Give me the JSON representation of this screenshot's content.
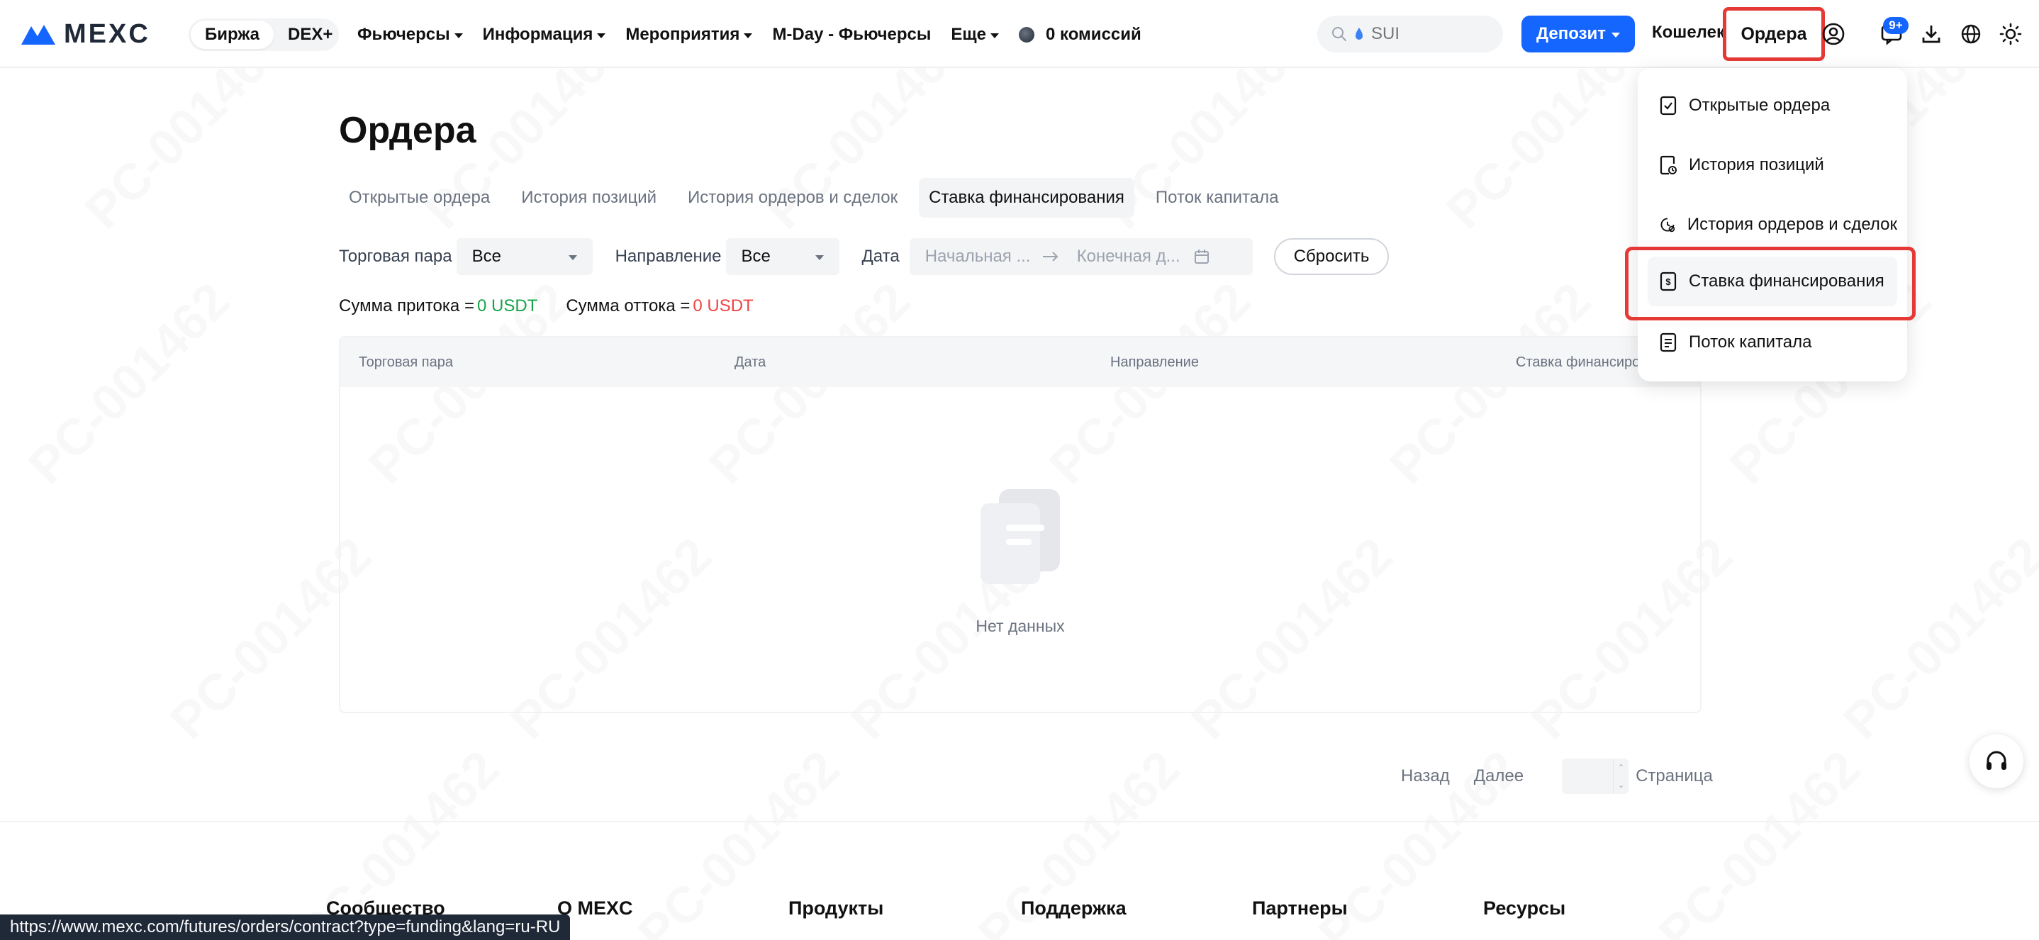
{
  "header": {
    "logo_text": "MEXC",
    "segments": [
      "Биржа",
      "DEX+"
    ],
    "nav": [
      {
        "label": "Фьючерсы",
        "caret": true
      },
      {
        "label": "Информация",
        "caret": true
      },
      {
        "label": "Мероприятия",
        "caret": true
      },
      {
        "label": "M-Day - Фьючерсы",
        "caret": false
      },
      {
        "label": "Еще",
        "caret": true
      }
    ],
    "zero_fee": "0 комиссий",
    "search": {
      "placeholder": "SUI",
      "icon": "search-icon"
    },
    "deposit_label": "Депозит",
    "wallet_label": "Кошелек",
    "orders_label": "Ордера",
    "badge": "9+",
    "brand_color": "#1565ff",
    "highlight_color": "#e53935"
  },
  "page": {
    "title": "Ордера",
    "tabs": [
      {
        "label": "Открытые ордера",
        "active": false
      },
      {
        "label": "История позиций",
        "active": false
      },
      {
        "label": "История ордеров и сделок",
        "active": false
      },
      {
        "label": "Ставка финансирования",
        "active": true
      },
      {
        "label": "Поток капитала",
        "active": false
      }
    ],
    "filters": {
      "pair_label": "Торговая пара",
      "pair_value": "Все",
      "direction_label": "Направление",
      "direction_value": "Все",
      "date_label": "Дата",
      "start_placeholder": "Начальная ...",
      "end_placeholder": "Конечная д...",
      "reset_label": "Сбросить"
    },
    "sums": {
      "inflow_label": "Сумма притока =",
      "inflow_value": "0 USDT",
      "outflow_label": "Сумма оттока =",
      "outflow_value": "0 USDT"
    },
    "table": {
      "columns": [
        "Торговая пара",
        "Дата",
        "Направление",
        "Ставка финансирования"
      ],
      "rows": [],
      "empty_text": "Нет данных"
    },
    "pager": {
      "prev": "Назад",
      "next": "Далее",
      "page_label": "Страница",
      "page_value": ""
    }
  },
  "dropdown": {
    "items": [
      {
        "label": "Открытые ордера",
        "icon": "check-document-icon",
        "active": false
      },
      {
        "label": "История позиций",
        "icon": "clock-document-icon",
        "active": false
      },
      {
        "label": "История ордеров и сделок",
        "icon": "history-clock-icon",
        "active": false
      },
      {
        "label": "Ставка финансирования",
        "icon": "dollar-document-icon",
        "active": true
      },
      {
        "label": "Поток капитала",
        "icon": "list-document-icon",
        "active": false
      }
    ]
  },
  "footer": {
    "columns": [
      "Сообщество",
      "О MEXC",
      "Продукты",
      "Поддержка",
      "Партнеры",
      "Ресурсы"
    ]
  },
  "status_bar_url": "https://www.mexc.com/futures/orders/contract?type=funding&lang=ru-RU",
  "watermark": "PC-001462"
}
